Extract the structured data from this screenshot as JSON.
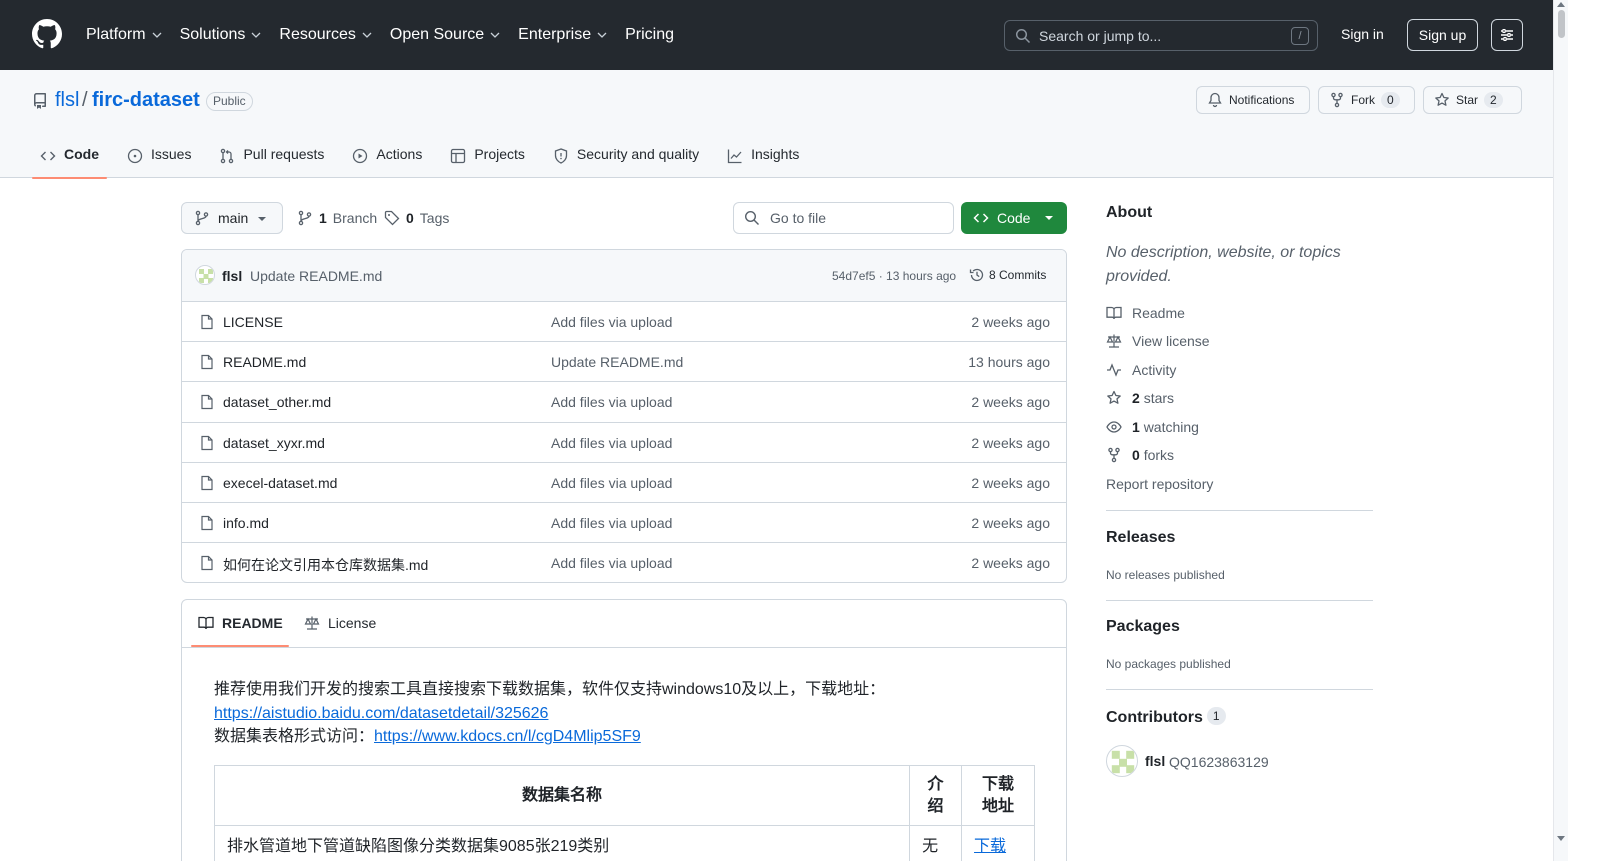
{
  "header": {
    "nav": [
      "Platform",
      "Solutions",
      "Resources",
      "Open Source",
      "Enterprise",
      "Pricing"
    ],
    "search_placeholder": "Search or jump to...",
    "search_key": "/",
    "sign_in": "Sign in",
    "sign_up": "Sign up"
  },
  "repo": {
    "owner": "flsl",
    "slash": "/",
    "name": "firc-dataset",
    "visibility": "Public",
    "notifications_label": "Notifications",
    "fork_label": "Fork",
    "fork_count": "0",
    "star_label": "Star",
    "star_count": "2",
    "tabs": [
      "Code",
      "Issues",
      "Pull requests",
      "Actions",
      "Projects",
      "Security and quality",
      "Insights"
    ]
  },
  "toolbar": {
    "branch": "main",
    "branch_count": "1",
    "branch_label": "Branch",
    "tag_count": "0",
    "tag_label": "Tags",
    "goto_file": "Go to file",
    "code_button": "Code"
  },
  "commit": {
    "author": "flsl",
    "message": "Update README.md",
    "meta": "54d7ef5 · 13 hours ago",
    "count_label": "8 Commits"
  },
  "files": [
    {
      "name": "LICENSE",
      "message": "Add files via upload",
      "date": "2 weeks ago"
    },
    {
      "name": "README.md",
      "message": "Update README.md",
      "date": "13 hours ago"
    },
    {
      "name": "dataset_other.md",
      "message": "Add files via upload",
      "date": "2 weeks ago"
    },
    {
      "name": "dataset_xyxr.md",
      "message": "Add files via upload",
      "date": "2 weeks ago"
    },
    {
      "name": "execel-dataset.md",
      "message": "Add files via upload",
      "date": "2 weeks ago"
    },
    {
      "name": "info.md",
      "message": "Add files via upload",
      "date": "2 weeks ago"
    },
    {
      "name": "如何在论文引用本仓库数据集.md",
      "message": "Add files via upload",
      "date": "2 weeks ago"
    }
  ],
  "readme": {
    "tab_readme": "README",
    "tab_license": "License",
    "line1": "推荐使用我们开发的搜索工具直接搜索下载数据集，软件仅支持windows10及以上，下载地址：",
    "link1": "https://aistudio.baidu.com/datasetdetail/325626",
    "line3_prefix": "数据集表格形式访问：",
    "link2": "https://www.kdocs.cn/l/cgD4Mlip5SF9",
    "table": {
      "headers": [
        "数据集名称",
        "介绍",
        "下载地址"
      ],
      "rows": [
        {
          "name": "排水管道地下管道缺陷图像分类数据集9085张219类别",
          "intro": "无",
          "download": "下载"
        }
      ]
    }
  },
  "sidebar": {
    "about_title": "About",
    "description": "No description, website, or topics provided.",
    "readme": "Readme",
    "license": "View license",
    "activity": "Activity",
    "stars_count": "2",
    "stars_label": "stars",
    "watching_count": "1",
    "watching_label": "watching",
    "forks_count": "0",
    "forks_label": "forks",
    "report": "Report repository",
    "releases_title": "Releases",
    "releases_note": "No releases published",
    "packages_title": "Packages",
    "packages_note": "No packages published",
    "contributors_title": "Contributors",
    "contributors_count": "1",
    "contributor_name": "flsl",
    "contributor_sub": "QQ1623863129"
  }
}
